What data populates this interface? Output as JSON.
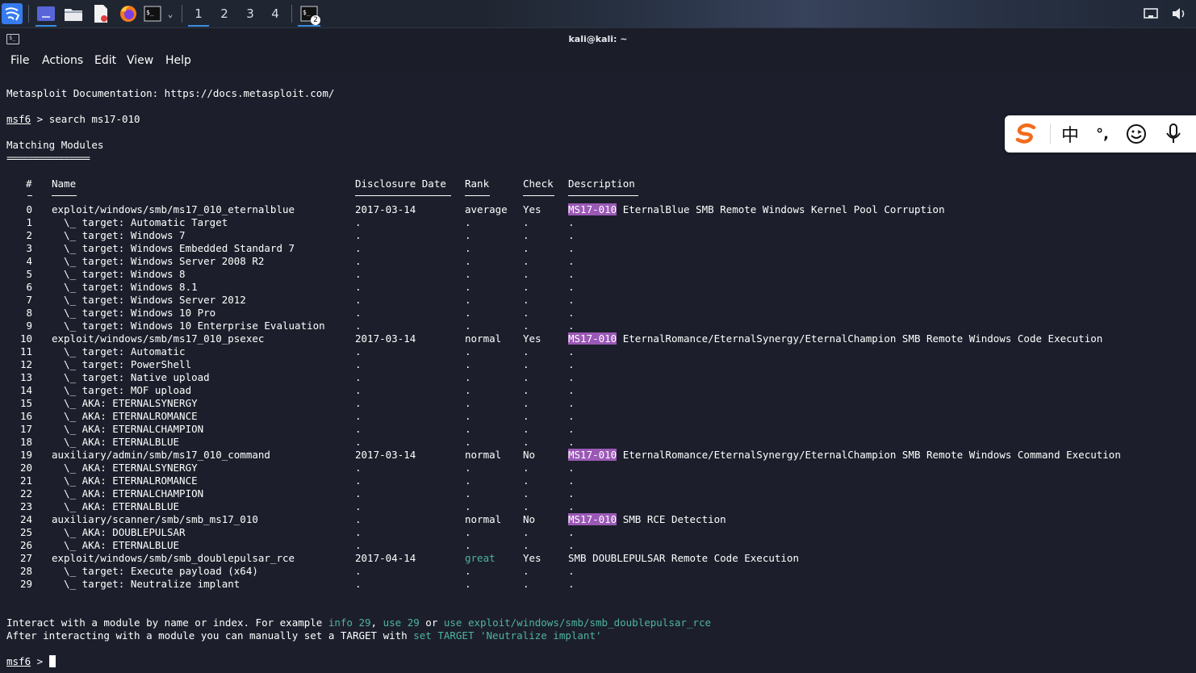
{
  "taskbar": {
    "apps": [
      {
        "icon": "kali-menu-icon",
        "label": "Kali menu"
      },
      {
        "icon": "desktop-icon",
        "label": "Show desktop"
      },
      {
        "icon": "file-manager-icon",
        "label": "Files"
      },
      {
        "icon": "text-editor-icon",
        "label": "Text editor"
      },
      {
        "icon": "firefox-icon",
        "label": "Firefox"
      },
      {
        "icon": "terminal-icon",
        "label": "Terminal"
      }
    ],
    "workspaces": [
      "1",
      "2",
      "3",
      "4"
    ],
    "terminal_badge": "2",
    "tray": {
      "network_icon": "network-icon",
      "volume_icon": "volume-icon"
    }
  },
  "window": {
    "title": "kali@kali: ~",
    "menu": [
      "File",
      "Actions",
      "Edit",
      "View",
      "Help"
    ]
  },
  "terminal": {
    "doc_line": "Metasploit Documentation: https://docs.metasploit.com/",
    "prompt": "msf6",
    "prompt_sep": " > ",
    "command": "search ms17-010",
    "heading": "Matching Modules",
    "heading_rule": "================",
    "columns": {
      "num": "#",
      "name": "Name",
      "date": "Disclosure Date",
      "rank": "Rank",
      "check": "Check",
      "desc": "Description"
    },
    "rows": [
      {
        "n": "0",
        "name": "exploit/windows/smb/ms17_010_eternalblue",
        "date": "2017-03-14",
        "rank": "average",
        "check": "Yes",
        "tag": "MS17-010",
        "desc": " EternalBlue SMB Remote Windows Kernel Pool Corruption"
      },
      {
        "n": "1",
        "name": "  \\_ target: Automatic Target",
        "date": ".",
        "rank": ".",
        "check": ".",
        "tag": "",
        "desc": "."
      },
      {
        "n": "2",
        "name": "  \\_ target: Windows 7",
        "date": ".",
        "rank": ".",
        "check": ".",
        "tag": "",
        "desc": "."
      },
      {
        "n": "3",
        "name": "  \\_ target: Windows Embedded Standard 7",
        "date": ".",
        "rank": ".",
        "check": ".",
        "tag": "",
        "desc": "."
      },
      {
        "n": "4",
        "name": "  \\_ target: Windows Server 2008 R2",
        "date": ".",
        "rank": ".",
        "check": ".",
        "tag": "",
        "desc": "."
      },
      {
        "n": "5",
        "name": "  \\_ target: Windows 8",
        "date": ".",
        "rank": ".",
        "check": ".",
        "tag": "",
        "desc": "."
      },
      {
        "n": "6",
        "name": "  \\_ target: Windows 8.1",
        "date": ".",
        "rank": ".",
        "check": ".",
        "tag": "",
        "desc": "."
      },
      {
        "n": "7",
        "name": "  \\_ target: Windows Server 2012",
        "date": ".",
        "rank": ".",
        "check": ".",
        "tag": "",
        "desc": "."
      },
      {
        "n": "8",
        "name": "  \\_ target: Windows 10 Pro",
        "date": ".",
        "rank": ".",
        "check": ".",
        "tag": "",
        "desc": "."
      },
      {
        "n": "9",
        "name": "  \\_ target: Windows 10 Enterprise Evaluation",
        "date": ".",
        "rank": ".",
        "check": ".",
        "tag": "",
        "desc": "."
      },
      {
        "n": "10",
        "name": "exploit/windows/smb/ms17_010_psexec",
        "date": "2017-03-14",
        "rank": "normal",
        "check": "Yes",
        "tag": "MS17-010",
        "desc": " EternalRomance/EternalSynergy/EternalChampion SMB Remote Windows Code Execution"
      },
      {
        "n": "11",
        "name": "  \\_ target: Automatic",
        "date": ".",
        "rank": ".",
        "check": ".",
        "tag": "",
        "desc": "."
      },
      {
        "n": "12",
        "name": "  \\_ target: PowerShell",
        "date": ".",
        "rank": ".",
        "check": ".",
        "tag": "",
        "desc": "."
      },
      {
        "n": "13",
        "name": "  \\_ target: Native upload",
        "date": ".",
        "rank": ".",
        "check": ".",
        "tag": "",
        "desc": "."
      },
      {
        "n": "14",
        "name": "  \\_ target: MOF upload",
        "date": ".",
        "rank": ".",
        "check": ".",
        "tag": "",
        "desc": "."
      },
      {
        "n": "15",
        "name": "  \\_ AKA: ETERNALSYNERGY",
        "date": ".",
        "rank": ".",
        "check": ".",
        "tag": "",
        "desc": "."
      },
      {
        "n": "16",
        "name": "  \\_ AKA: ETERNALROMANCE",
        "date": ".",
        "rank": ".",
        "check": ".",
        "tag": "",
        "desc": "."
      },
      {
        "n": "17",
        "name": "  \\_ AKA: ETERNALCHAMPION",
        "date": ".",
        "rank": ".",
        "check": ".",
        "tag": "",
        "desc": "."
      },
      {
        "n": "18",
        "name": "  \\_ AKA: ETERNALBLUE",
        "date": ".",
        "rank": ".",
        "check": ".",
        "tag": "",
        "desc": "."
      },
      {
        "n": "19",
        "name": "auxiliary/admin/smb/ms17_010_command",
        "date": "2017-03-14",
        "rank": "normal",
        "check": "No",
        "tag": "MS17-010",
        "desc": " EternalRomance/EternalSynergy/EternalChampion SMB Remote Windows Command Execution"
      },
      {
        "n": "20",
        "name": "  \\_ AKA: ETERNALSYNERGY",
        "date": ".",
        "rank": ".",
        "check": ".",
        "tag": "",
        "desc": "."
      },
      {
        "n": "21",
        "name": "  \\_ AKA: ETERNALROMANCE",
        "date": ".",
        "rank": ".",
        "check": ".",
        "tag": "",
        "desc": "."
      },
      {
        "n": "22",
        "name": "  \\_ AKA: ETERNALCHAMPION",
        "date": ".",
        "rank": ".",
        "check": ".",
        "tag": "",
        "desc": "."
      },
      {
        "n": "23",
        "name": "  \\_ AKA: ETERNALBLUE",
        "date": ".",
        "rank": ".",
        "check": ".",
        "tag": "",
        "desc": "."
      },
      {
        "n": "24",
        "name": "auxiliary/scanner/smb/smb_ms17_010",
        "date": ".",
        "rank": "normal",
        "check": "No",
        "tag": "MS17-010",
        "desc": " SMB RCE Detection"
      },
      {
        "n": "25",
        "name": "  \\_ AKA: DOUBLEPULSAR",
        "date": ".",
        "rank": ".",
        "check": ".",
        "tag": "",
        "desc": "."
      },
      {
        "n": "26",
        "name": "  \\_ AKA: ETERNALBLUE",
        "date": ".",
        "rank": ".",
        "check": ".",
        "tag": "",
        "desc": "."
      },
      {
        "n": "27",
        "name": "exploit/windows/smb/smb_doublepulsar_rce",
        "date": "2017-04-14",
        "rank": "great",
        "rank_color": "green",
        "check": "Yes",
        "tag": "",
        "desc": "SMB DOUBLEPULSAR Remote Code Execution"
      },
      {
        "n": "28",
        "name": "  \\_ target: Execute payload (x64)",
        "date": ".",
        "rank": ".",
        "check": ".",
        "tag": "",
        "desc": "."
      },
      {
        "n": "29",
        "name": "  \\_ target: Neutralize implant",
        "date": ".",
        "rank": ".",
        "check": ".",
        "tag": "",
        "desc": "."
      }
    ],
    "footer1": {
      "a": "Interact with a module by name or index. For example ",
      "b": "info 29",
      "c": ", ",
      "d": "use 29",
      "e": " or ",
      "f": "use exploit/windows/smb/smb_doublepulsar_rce"
    },
    "footer2": {
      "a": "After interacting with a module you can manually set a TARGET with ",
      "b": "set TARGET 'Neutralize implant'"
    },
    "colors": {
      "highlight": "#9b59b6",
      "accent_text": "#4fb3a1",
      "background": "#1c1f2b"
    }
  },
  "ime": {
    "logo": "sogou-s-icon",
    "mode": "中",
    "punct": "°,",
    "emoji_icon": "emoji-icon",
    "mic_icon": "microphone-icon"
  }
}
